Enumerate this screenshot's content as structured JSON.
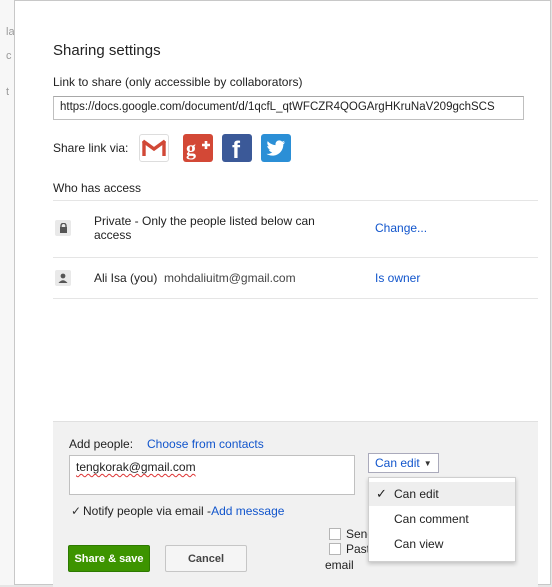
{
  "dialog": {
    "title": "Sharing settings",
    "link_label": "Link to share (only accessible by collaborators)",
    "link_value": "https://docs.google.com/document/d/1qcfL_qtWFCZR4QOGArgHKruNaV209gchSCS",
    "share_via_label": "Share link via:",
    "social_icons": [
      "gmail-icon",
      "google-plus-icon",
      "facebook-icon",
      "twitter-icon"
    ],
    "who_has_access": "Who has access",
    "access": [
      {
        "icon": "lock-icon",
        "text": "Private - Only the people listed below can access",
        "action": "Change..."
      },
      {
        "icon": "person-icon",
        "name": "Ali Isa (you)",
        "email": "mohdaliuitm@gmail.com",
        "action": "Is owner"
      }
    ],
    "footer": {
      "add_people_label": "Add people:",
      "choose_contacts": "Choose from contacts",
      "people_value": "tengkorak@gmail.com",
      "permission": "Can edit",
      "notify_label": "Notify people via email - ",
      "add_message": "Add message",
      "send_copy_label": "Send a",
      "paste_label": "Paste t",
      "paste_wrap": "email",
      "share_save": "Share & save",
      "cancel": "Cancel"
    },
    "permission_menu": [
      {
        "label": "Can edit",
        "selected": true
      },
      {
        "label": "Can comment",
        "selected": false
      },
      {
        "label": "Can view",
        "selected": false
      }
    ]
  },
  "background": {
    "glyphs": [
      "la",
      "c",
      "t"
    ]
  },
  "colors": {
    "link": "#1155cc",
    "share_button": "#3d9400",
    "gplus": "#d34836",
    "facebook": "#3b5998",
    "twitter": "#2b8fd6"
  }
}
